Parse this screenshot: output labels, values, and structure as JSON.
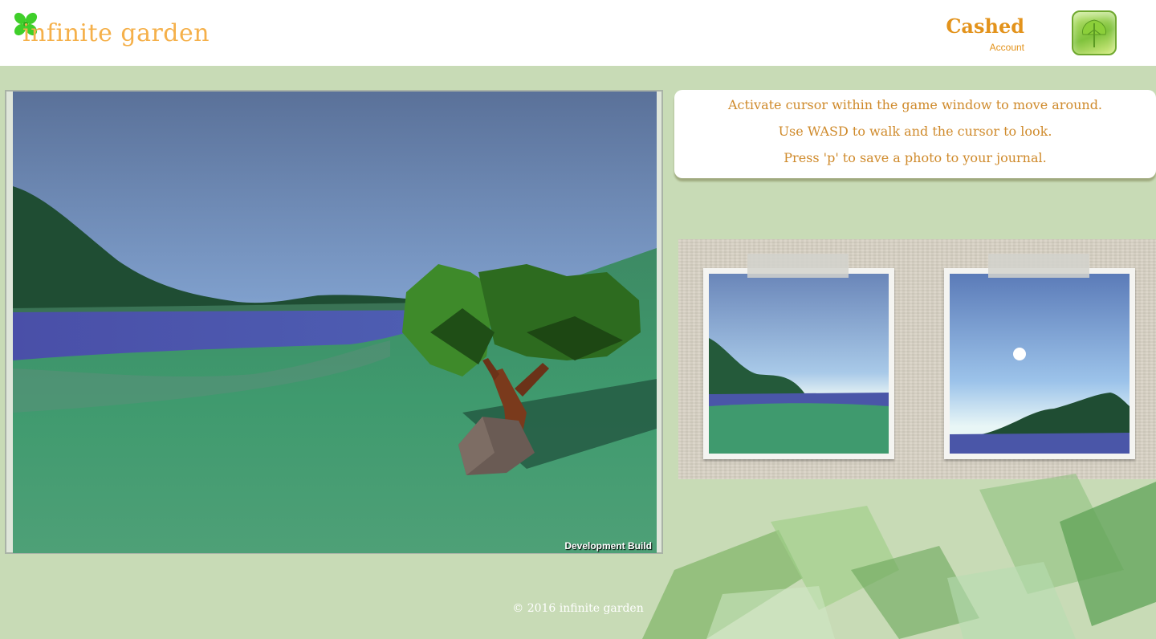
{
  "header": {
    "logo_text": "infinite garden",
    "username": "Cashed",
    "account_label": "Account"
  },
  "game": {
    "dev_build_label": "Development Build"
  },
  "instructions": {
    "lines": [
      "Activate cursor within the game window to move around.",
      "Use WASD to walk and the cursor to look.",
      "Press 'p' to save a photo to your journal."
    ]
  },
  "journal": {
    "photo_count": 2
  },
  "footer": {
    "copyright": "© 2016 infinite garden"
  },
  "colors": {
    "page_bg": "#c8dbb6",
    "accent_orange": "#e3931c",
    "logo_orange": "#f5b04a",
    "clover_green": "#3fcf2a"
  }
}
